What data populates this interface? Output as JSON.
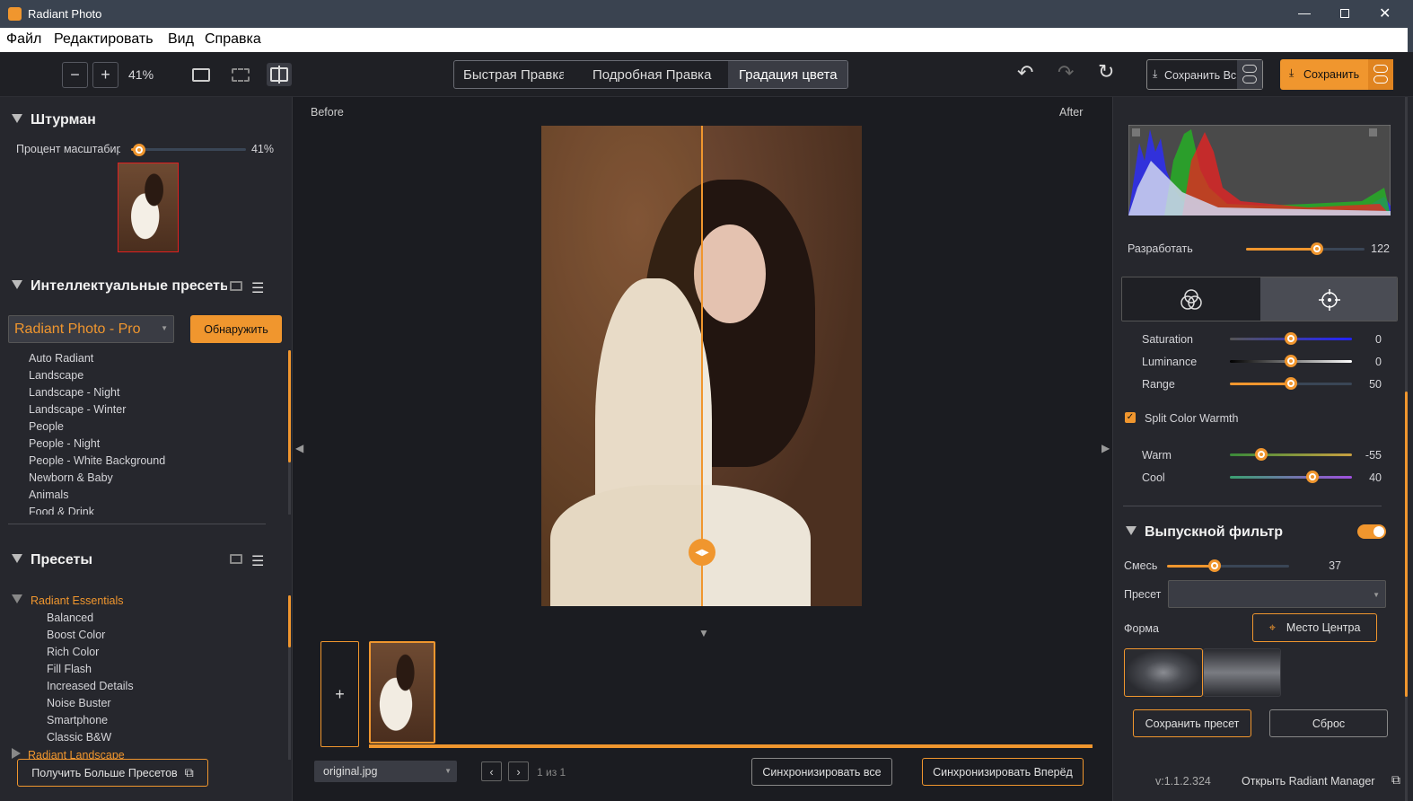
{
  "window": {
    "title": "Radiant Photo"
  },
  "menu": [
    "Файл",
    "Редактировать",
    "Вид",
    "Справка"
  ],
  "toolbar": {
    "zoom": "41%",
    "tabs": [
      "Быстрая Правка",
      "Подробная Правка",
      "Градация цвета"
    ],
    "active_tab": 2,
    "save_all": "Сохранить Все",
    "save": "Сохранить"
  },
  "navigator": {
    "title": "Штурман",
    "zoom_label": "Процент масштабирования",
    "zoom_value": "41%",
    "zoom_fraction": 0.05
  },
  "smart_presets": {
    "title": "Интеллектуальные пресеты",
    "dropdown": "Radiant Photo - Pro",
    "detect_button": "Обнаружить",
    "items": [
      "Auto Radiant",
      "Landscape",
      "Landscape - Night",
      "Landscape - Winter",
      "People",
      "People - Night",
      "People - White Background",
      "Newborn & Baby",
      "Animals",
      "Food & Drink"
    ]
  },
  "presets": {
    "title": "Пресеты",
    "group_open": "Radiant Essentials",
    "items": [
      "Balanced",
      "Boost Color",
      "Rich Color",
      "Fill Flash",
      "Increased Details",
      "Noise Buster",
      "Smartphone",
      "Classic B&W"
    ],
    "group_closed": "Radiant Landscape",
    "more_button": "Получить Больше Пресетов"
  },
  "viewer": {
    "before": "Before",
    "after": "After",
    "split_fraction": 0.5
  },
  "filmstrip": {
    "file": "original.jpg",
    "page": "1 из 1",
    "sync_all": "Синхронизировать все",
    "sync_forward": "Синхронизировать Вперёд",
    "add": "+"
  },
  "right": {
    "develop": {
      "label": "Разработать",
      "value": "122",
      "fraction": 0.58
    },
    "sliders": [
      {
        "label": "Saturation",
        "value": "0",
        "fraction": 0.5
      },
      {
        "label": "Luminance",
        "value": "0",
        "fraction": 0.5
      },
      {
        "label": "Range",
        "value": "50",
        "fraction": 0.5
      }
    ],
    "split_warmth": {
      "label": "Split Color Warmth",
      "checked": true
    },
    "warmth": [
      {
        "label": "Warm",
        "value": "-55",
        "fraction": 0.25
      },
      {
        "label": "Cool",
        "value": "40",
        "fraction": 0.68
      }
    ],
    "grad_filter": {
      "title": "Выпускной фильтр",
      "enabled": true,
      "mix_label": "Смесь",
      "mix_value": "37",
      "mix_fraction": 0.37,
      "preset_label": "Пресет",
      "shape_label": "Форма",
      "center_button": "Место Центра",
      "save_preset": "Сохранить пресет",
      "reset": "Сброс"
    },
    "version": "v:1.1.2.324",
    "manager": "Открыть Radiant Manager"
  },
  "colors": {
    "accent": "#f0962e",
    "panel": "#26272d",
    "bg": "#1b1c21"
  }
}
